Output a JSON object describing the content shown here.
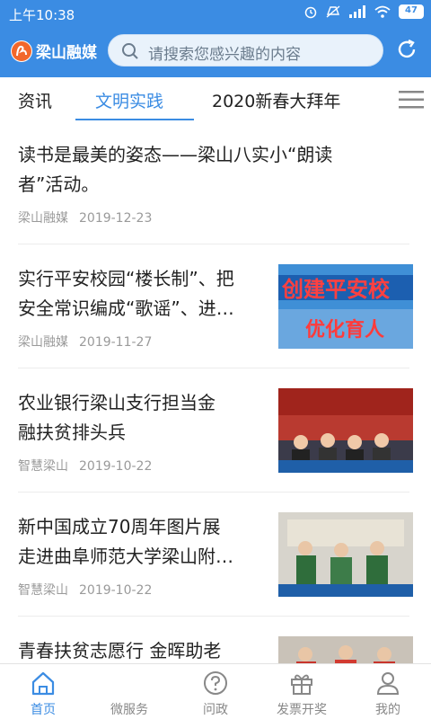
{
  "status": {
    "time": "上午10:38",
    "battery": "47"
  },
  "header": {
    "logo_text": "梁山融媒",
    "search_placeholder": "请搜索您感兴趣的内容"
  },
  "tabs": [
    {
      "label": "资讯"
    },
    {
      "label": "文明实践"
    },
    {
      "label": "2020新春大拜年"
    }
  ],
  "feed": [
    {
      "title_line1": "读书是最美的姿态——梁山八实小“朗读",
      "title_line2": "者”活动。",
      "source": "梁山融媒",
      "date": "2019-12-23"
    },
    {
      "title_line1": "实行平安校园“楼长制”、把",
      "title_line2": "安全常识编成“歌谣”、进…",
      "source": "梁山融媒",
      "date": "2019-11-27",
      "thumb_text": "创建平安校  优化育人"
    },
    {
      "title_line1": "农业银行梁山支行担当金",
      "title_line2": "融扶贫排头兵",
      "source": "智慧梁山",
      "date": "2019-10-22"
    },
    {
      "title_line1": "新中国成立70周年图片展",
      "title_line2": "走进曲阜师范大学梁山附…",
      "source": "智慧梁山",
      "date": "2019-10-22"
    },
    {
      "title_line1": "青春扶贫志愿行 金晖助老"
    }
  ],
  "bottom_nav": [
    {
      "label": "首页",
      "icon": "home-icon"
    },
    {
      "label": "微服务",
      "icon": "micro-service-icon"
    },
    {
      "label": "问政",
      "icon": "question-icon"
    },
    {
      "label": "发票开奖",
      "icon": "gift-icon"
    },
    {
      "label": "我的",
      "icon": "profile-icon"
    }
  ],
  "colors": {
    "brand_blue": "#3b8ce3",
    "meta_gray": "#9a9a9a"
  }
}
